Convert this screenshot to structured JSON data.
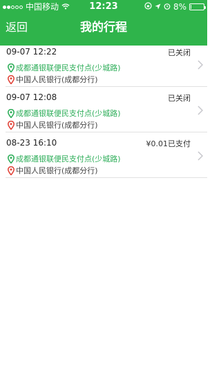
{
  "status_bar": {
    "carrier": "中国移动",
    "time": "12:23",
    "battery": "8%",
    "battery_level": 0.08
  },
  "nav": {
    "back_label": "返回",
    "title": "我的行程"
  },
  "colors": {
    "header": "#2fb44b",
    "origin_pin": "#2fae5a",
    "destination_pin": "#e1453a"
  },
  "trips": [
    {
      "time": "09-07 12:22",
      "status": "已关闭",
      "origin": "成都通银联便民支付点(少城路)",
      "destination": "中国人民银行(成都分行)"
    },
    {
      "time": "09-07 12:08",
      "status": "已关闭",
      "origin": "成都通银联便民支付点(少城路)",
      "destination": "中国人民银行(成都分行)"
    },
    {
      "time": "08-23 16:10",
      "status": "¥0.01已支付",
      "origin": "成都通银联便民支付点(少城路)",
      "destination": "中国人民银行(成都分行)"
    }
  ]
}
